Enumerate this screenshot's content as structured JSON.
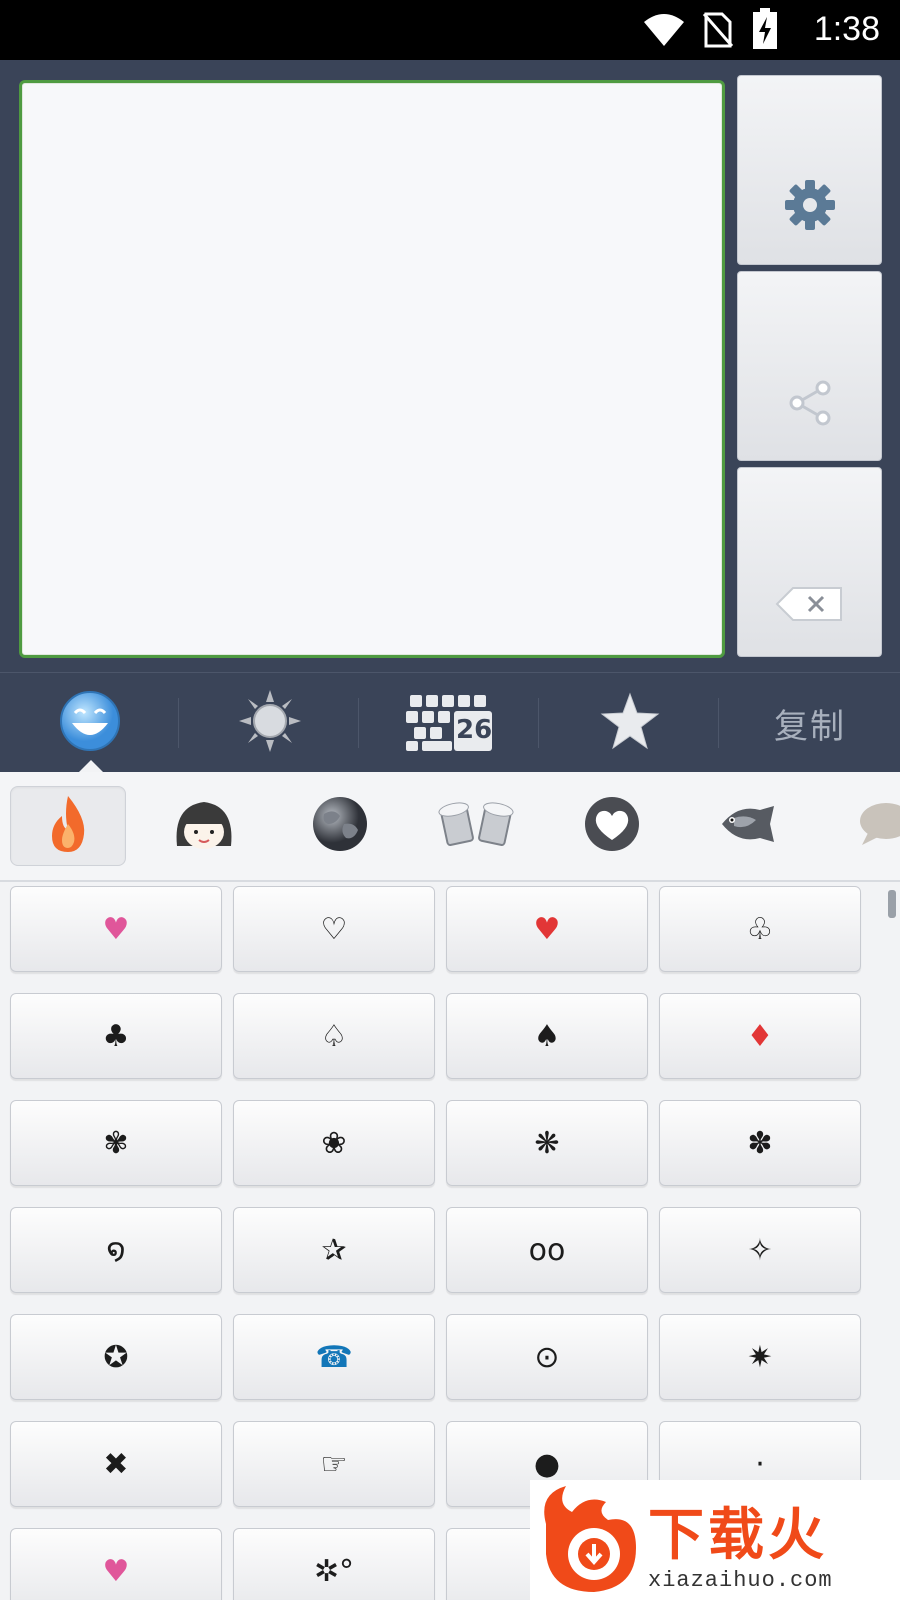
{
  "status_bar": {
    "time": "1:38",
    "icons": [
      "wifi-icon",
      "no-sim-icon",
      "battery-charging-icon"
    ]
  },
  "text_area": {
    "value": ""
  },
  "side_buttons": [
    {
      "name": "settings-button",
      "icon": "gear-icon"
    },
    {
      "name": "share-button",
      "icon": "share-icon"
    },
    {
      "name": "backspace-button",
      "icon": "backspace-icon"
    }
  ],
  "tabs": [
    {
      "icon": "smiley-icon",
      "active": true
    },
    {
      "icon": "sun-icon"
    },
    {
      "icon": "keyboard-26-icon",
      "badge": "26"
    },
    {
      "icon": "star-icon"
    },
    {
      "label": "复制"
    }
  ],
  "categories": [
    {
      "icon": "flame-icon",
      "active": true
    },
    {
      "icon": "girl-face-icon"
    },
    {
      "icon": "globe-icon"
    },
    {
      "icon": "beer-mugs-icon"
    },
    {
      "icon": "heart-outline-icon"
    },
    {
      "icon": "fish-icon"
    },
    {
      "icon": "speech-bubble-icon"
    }
  ],
  "symbols": [
    "♥",
    "♡",
    "♥",
    "♧",
    "♣",
    "♤",
    "♠",
    "♦",
    "✾",
    "❀",
    "❋",
    "✽",
    "໑",
    "✰",
    "oo",
    "✧",
    "✪",
    "☎",
    "⊙",
    "✷",
    "✖",
    "☞",
    "●",
    "·",
    "♥",
    "✲°",
    "",
    ""
  ],
  "symbol_colors": {
    "pink": "#e0569a",
    "red": "#e23636",
    "blue": "#1276b8"
  },
  "colors": {
    "panel_bg": "#3a4458",
    "text_area_border": "#4f9b41",
    "watermark_orange": "#f04a19"
  },
  "watermark": {
    "title": "下载火",
    "url": "xiazaihuo.com"
  }
}
